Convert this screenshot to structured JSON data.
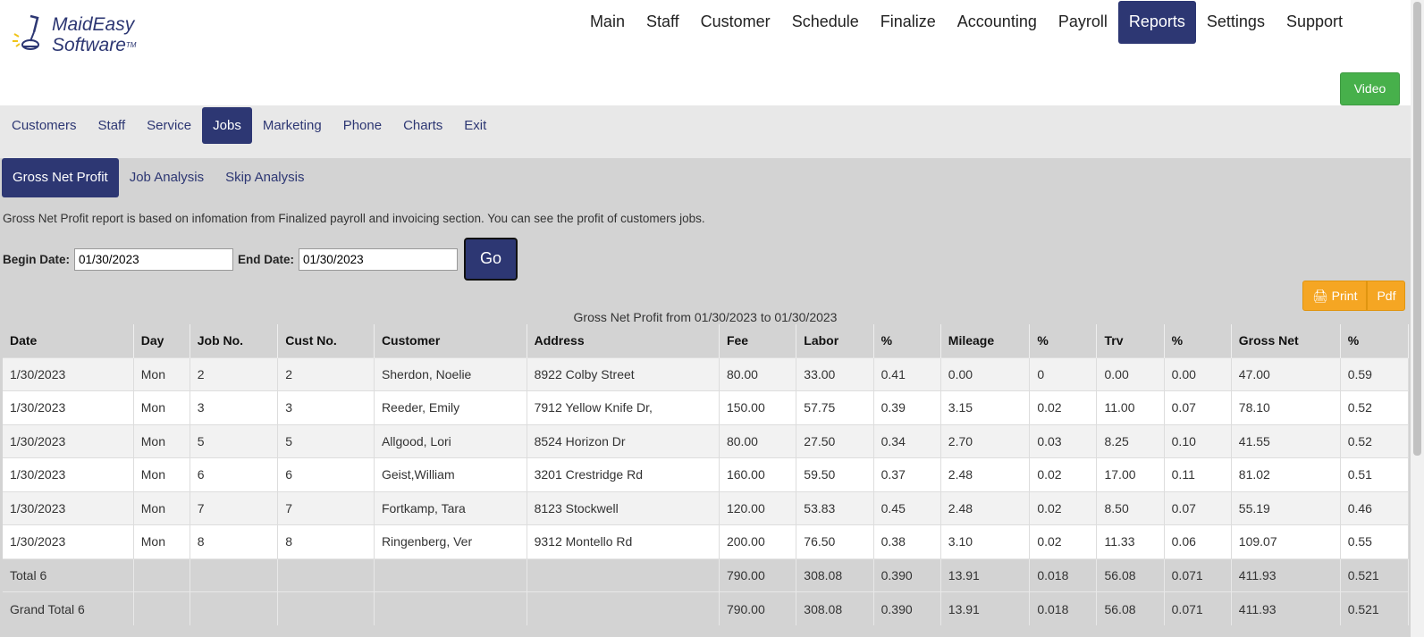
{
  "logo": {
    "line1": "MaidEasy",
    "line2": "Software",
    "tm": "TM"
  },
  "topnav": [
    "Main",
    "Staff",
    "Customer",
    "Schedule",
    "Finalize",
    "Accounting",
    "Payroll",
    "Reports",
    "Settings",
    "Support"
  ],
  "topnav_active": "Reports",
  "video_label": "Video",
  "subnav": [
    "Customers",
    "Staff",
    "Service",
    "Jobs",
    "Marketing",
    "Phone",
    "Charts",
    "Exit"
  ],
  "subnav_active": "Jobs",
  "tabs": [
    "Gross Net Profit",
    "Job Analysis",
    "Skip Analysis"
  ],
  "tabs_active": "Gross Net Profit",
  "description": "Gross Net Profit report is based on infomation from Finalized payroll and invoicing section. You can see the profit of customers jobs.",
  "filters": {
    "begin_label": "Begin Date:",
    "begin_value": "01/30/2023",
    "end_label": "End Date:",
    "end_value": "01/30/2023",
    "go_label": "Go"
  },
  "print_label": "Print",
  "pdf_label": "Pdf",
  "report_title": "Gross Net Profit from 01/30/2023 to 01/30/2023",
  "columns": [
    "Date",
    "Day",
    "Job No.",
    "Cust No.",
    "Customer",
    "Address",
    "Fee",
    "Labor",
    "%",
    "Mileage",
    "%",
    "Trv",
    "%",
    "Gross Net",
    "%"
  ],
  "rows": [
    [
      "1/30/2023",
      "Mon",
      "2",
      "2",
      "Sherdon, Noelie",
      "8922 Colby Street",
      "80.00",
      "33.00",
      "0.41",
      "0.00",
      "0",
      "0.00",
      "0.00",
      "47.00",
      "0.59"
    ],
    [
      "1/30/2023",
      "Mon",
      "3",
      "3",
      "Reeder, Emily",
      "7912 Yellow Knife Dr,",
      "150.00",
      "57.75",
      "0.39",
      "3.15",
      "0.02",
      "11.00",
      "0.07",
      "78.10",
      "0.52"
    ],
    [
      "1/30/2023",
      "Mon",
      "5",
      "5",
      "Allgood, Lori",
      "8524 Horizon Dr",
      "80.00",
      "27.50",
      "0.34",
      "2.70",
      "0.03",
      "8.25",
      "0.10",
      "41.55",
      "0.52"
    ],
    [
      "1/30/2023",
      "Mon",
      "6",
      "6",
      "Geist,William",
      "3201 Crestridge Rd",
      "160.00",
      "59.50",
      "0.37",
      "2.48",
      "0.02",
      "17.00",
      "0.11",
      "81.02",
      "0.51"
    ],
    [
      "1/30/2023",
      "Mon",
      "7",
      "7",
      "Fortkamp, Tara",
      "8123 Stockwell",
      "120.00",
      "53.83",
      "0.45",
      "2.48",
      "0.02",
      "8.50",
      "0.07",
      "55.19",
      "0.46"
    ],
    [
      "1/30/2023",
      "Mon",
      "8",
      "8",
      "Ringenberg, Ver",
      "9312 Montello Rd",
      "200.00",
      "76.50",
      "0.38",
      "3.10",
      "0.02",
      "11.33",
      "0.06",
      "109.07",
      "0.55"
    ]
  ],
  "totals": [
    [
      "Total 6",
      "",
      "",
      "",
      "",
      "",
      "790.00",
      "308.08",
      "0.390",
      "13.91",
      "0.018",
      "56.08",
      "0.071",
      "411.93",
      "0.521"
    ],
    [
      "Grand Total 6",
      "",
      "",
      "",
      "",
      "",
      "790.00",
      "308.08",
      "0.390",
      "13.91",
      "0.018",
      "56.08",
      "0.071",
      "411.93",
      "0.521"
    ]
  ]
}
